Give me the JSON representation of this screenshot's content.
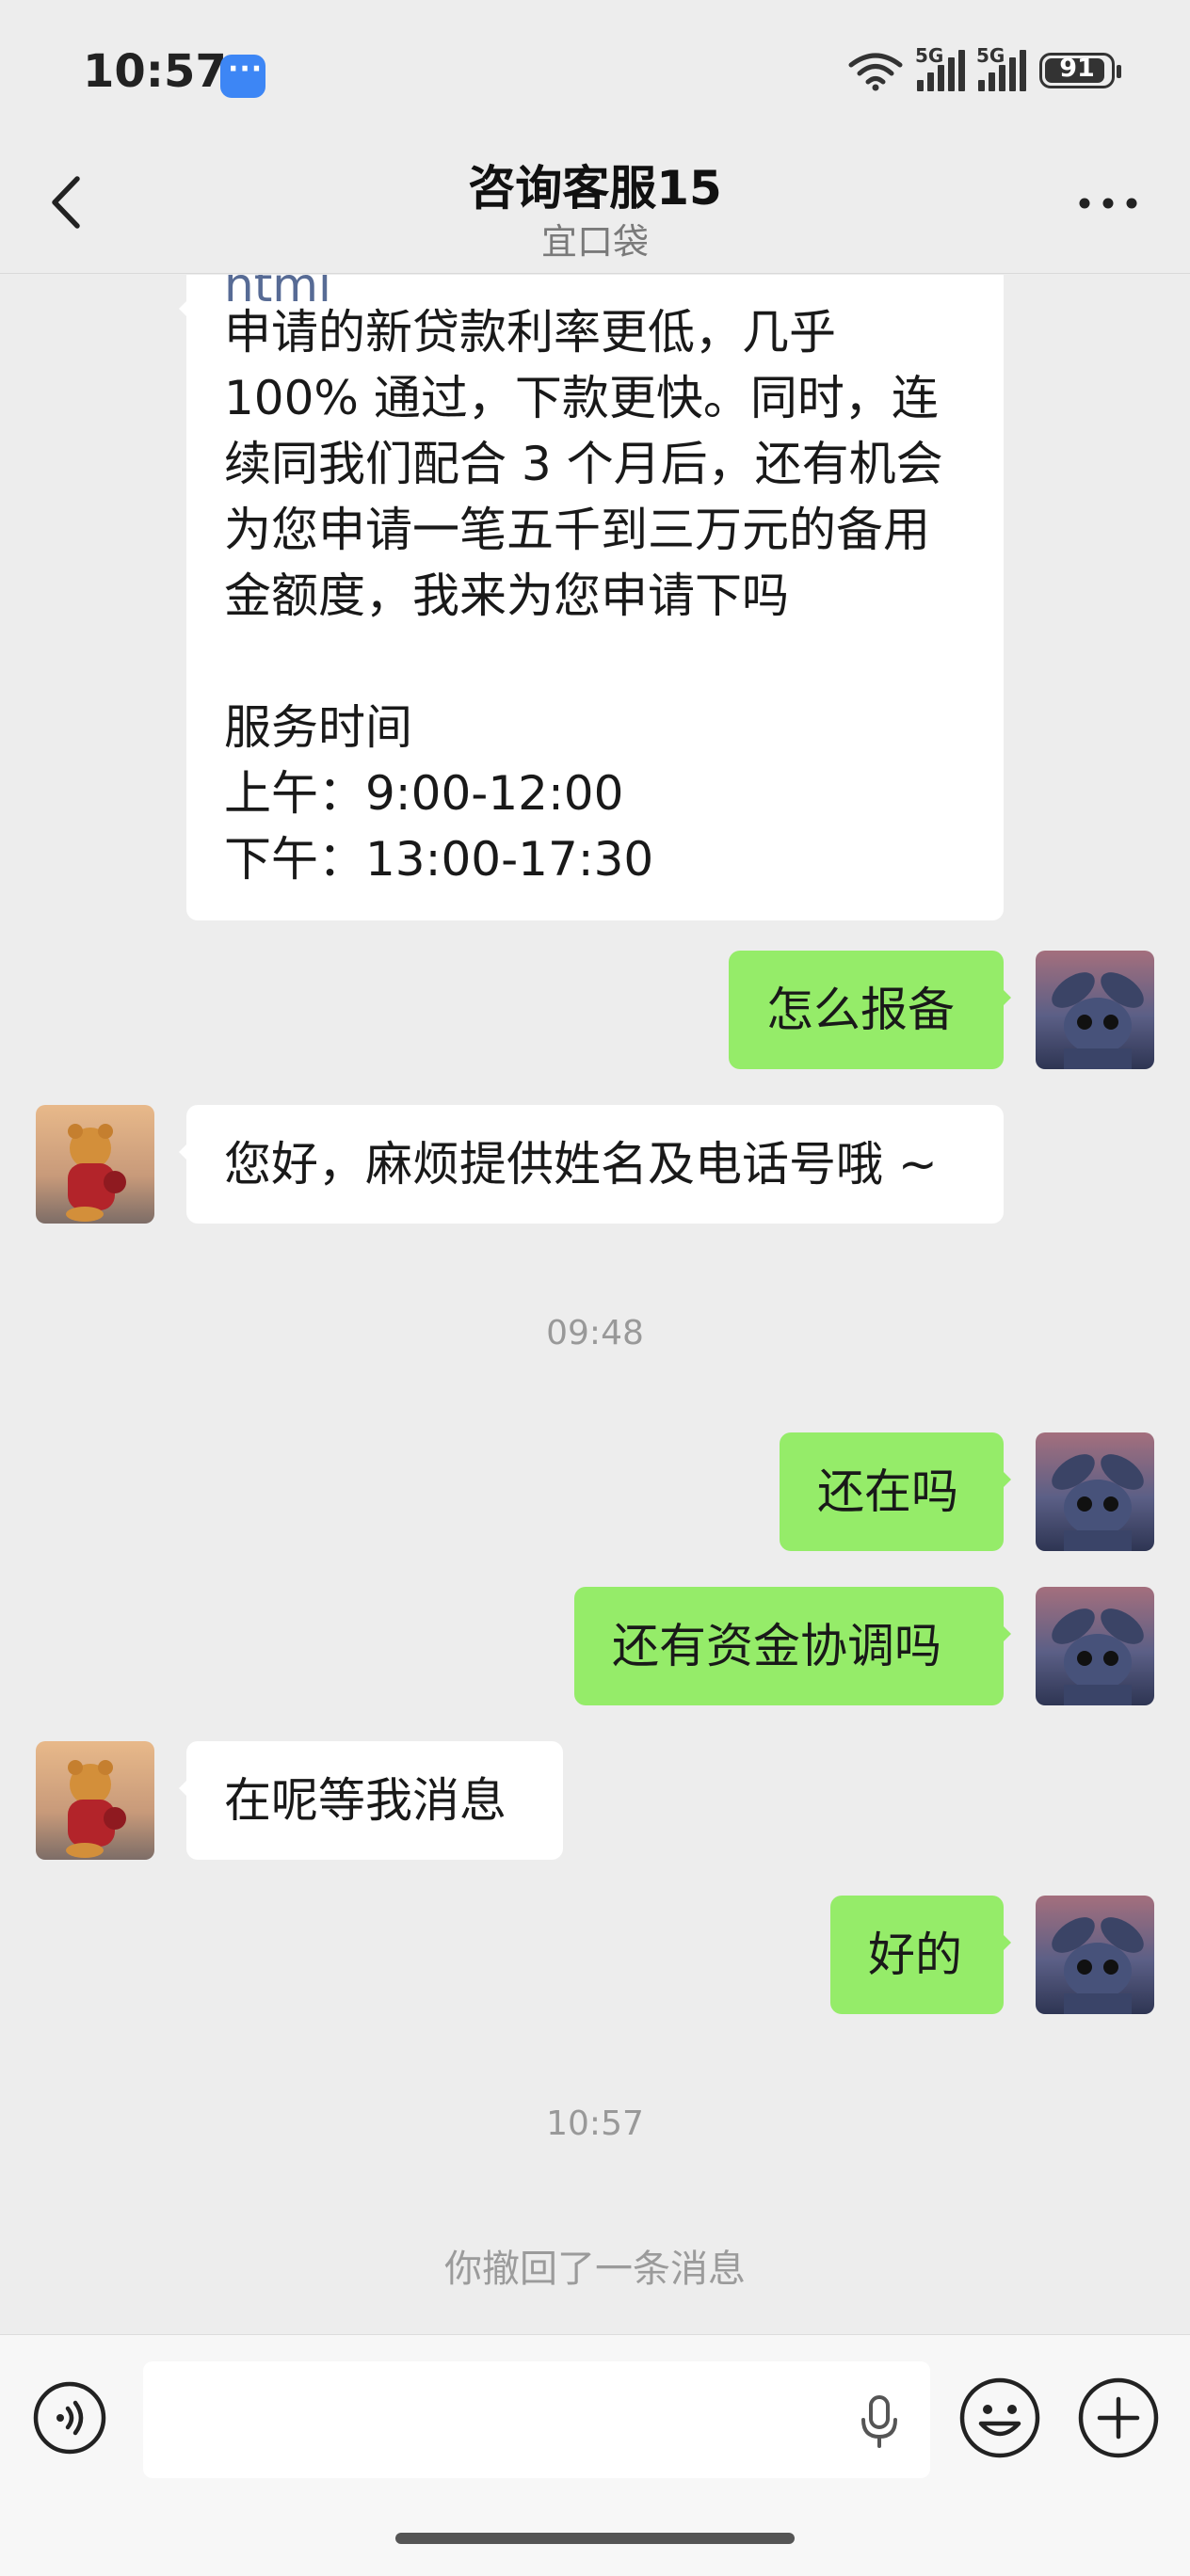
{
  "status_bar": {
    "time": "10:57",
    "signal1_label": "5G",
    "signal2_label": "5G",
    "battery": "91"
  },
  "header": {
    "title": "咨询客服15",
    "subtitle": "宜口袋"
  },
  "messages": {
    "m1": {
      "partial_top": "html",
      "lines": [
        "申请的新贷款利率更低，几乎",
        "100% 通过，下款更快。同时，连",
        "续同我们配合 3 个月后，还有机会",
        "为您申请一笔五千到三万元的备用",
        "金额度，我来为您申请下吗",
        "",
        "服务时间",
        "上午：9:00-12:00",
        "下午：13:00-17:30"
      ]
    },
    "m2": "怎么报备",
    "m3": "您好，麻烦提供姓名及电话号哦 ~",
    "t1": "09:48",
    "m4": "还在吗",
    "m5": "还有资金协调吗",
    "m6": "在呢等我消息",
    "m7": "好的",
    "t2": "10:57",
    "recall": "你撤回了一条消息"
  },
  "colors": {
    "background": "#ededed",
    "outgoing_bubble": "#95ec69",
    "incoming_bubble": "#ffffff",
    "link_text": "#576b95"
  },
  "icons": {
    "back": "chevron-left-icon",
    "more": "more-dots-icon",
    "voice": "voice-mode-icon",
    "mic": "microphone-icon",
    "emoji": "emoji-icon",
    "plus": "plus-icon"
  }
}
